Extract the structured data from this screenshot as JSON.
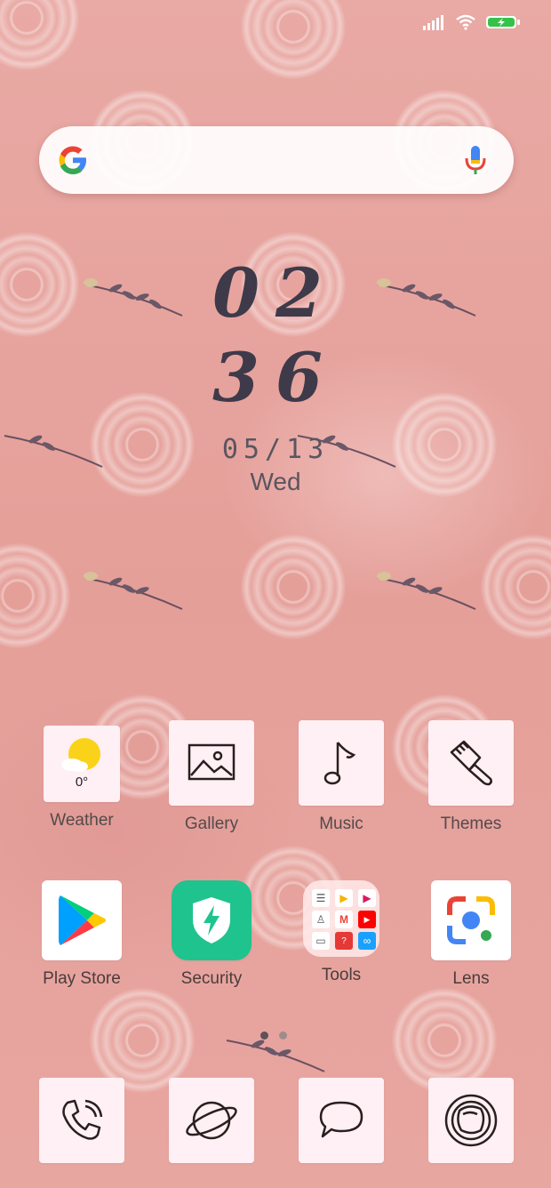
{
  "clock": {
    "hours": "02",
    "minutes": "36",
    "date": "05/13",
    "day": "Wed"
  },
  "weather": {
    "temp": "0°"
  },
  "apps_row1": [
    {
      "label": "Weather",
      "icon": "weather-sun-cloud-icon"
    },
    {
      "label": "Gallery",
      "icon": "image-icon"
    },
    {
      "label": "Music",
      "icon": "music-note-icon"
    },
    {
      "label": "Themes",
      "icon": "paint-brush-icon"
    }
  ],
  "apps_row2": [
    {
      "label": "Play Store",
      "icon": "play-store-icon"
    },
    {
      "label": "Security",
      "icon": "shield-bolt-icon"
    },
    {
      "label": "Tools",
      "icon": "folder-icon"
    },
    {
      "label": "Lens",
      "icon": "lens-icon"
    }
  ],
  "dock": [
    {
      "name": "phone",
      "icon": "phone-icon"
    },
    {
      "name": "browser",
      "icon": "planet-icon"
    },
    {
      "name": "messages",
      "icon": "chat-bubble-icon"
    },
    {
      "name": "camera",
      "icon": "camera-aperture-icon"
    }
  ],
  "page_indicator": {
    "current": 1,
    "total": 2
  },
  "colors": {
    "accent_green": "#1fc38e",
    "wallpaper": "#e7a39e",
    "tile": "#fef0f4"
  }
}
